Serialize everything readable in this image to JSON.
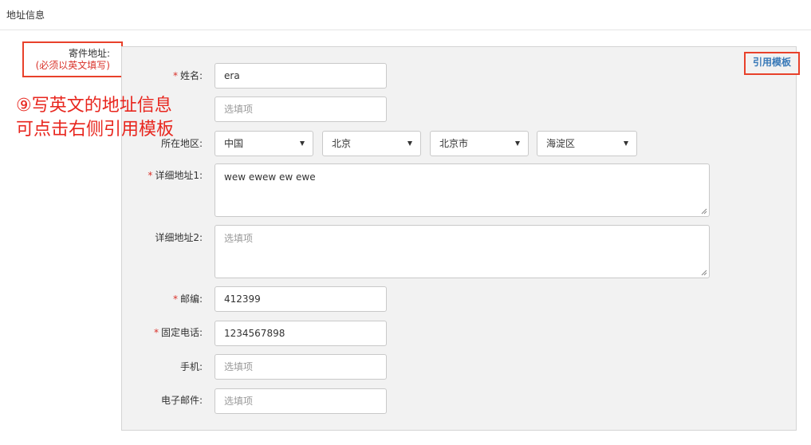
{
  "header": {
    "title": "地址信息"
  },
  "sender": {
    "label": "寄件地址:",
    "note": "(必须以英文填写)"
  },
  "template_button": "引用模板",
  "annotation": {
    "line1": "⑨写英文的地址信息",
    "line2": "可点击右侧引用模板"
  },
  "fields": {
    "name": {
      "label": "姓名:",
      "required": "*",
      "value": "era"
    },
    "optional_name": {
      "placeholder": "选填项"
    },
    "region": {
      "label": "所在地区:",
      "country": "中国",
      "province": "北京",
      "city": "北京市",
      "district": "海淀区"
    },
    "address1": {
      "label": "详细地址1:",
      "required": "*",
      "value": "wew ewew ew ewe"
    },
    "address2": {
      "label": "详细地址2:",
      "placeholder": "选填项"
    },
    "postcode": {
      "label": "邮编:",
      "required": "*",
      "value": "412399"
    },
    "phone": {
      "label": "固定电话:",
      "required": "*",
      "value": "1234567898"
    },
    "mobile": {
      "label": "手机:",
      "placeholder": "选填项"
    },
    "email": {
      "label": "电子邮件:",
      "placeholder": "选填项"
    }
  },
  "colors": {
    "accent_red": "#e8412b",
    "link_blue": "#3a7ab8",
    "panel_bg": "#f2f2f2"
  }
}
